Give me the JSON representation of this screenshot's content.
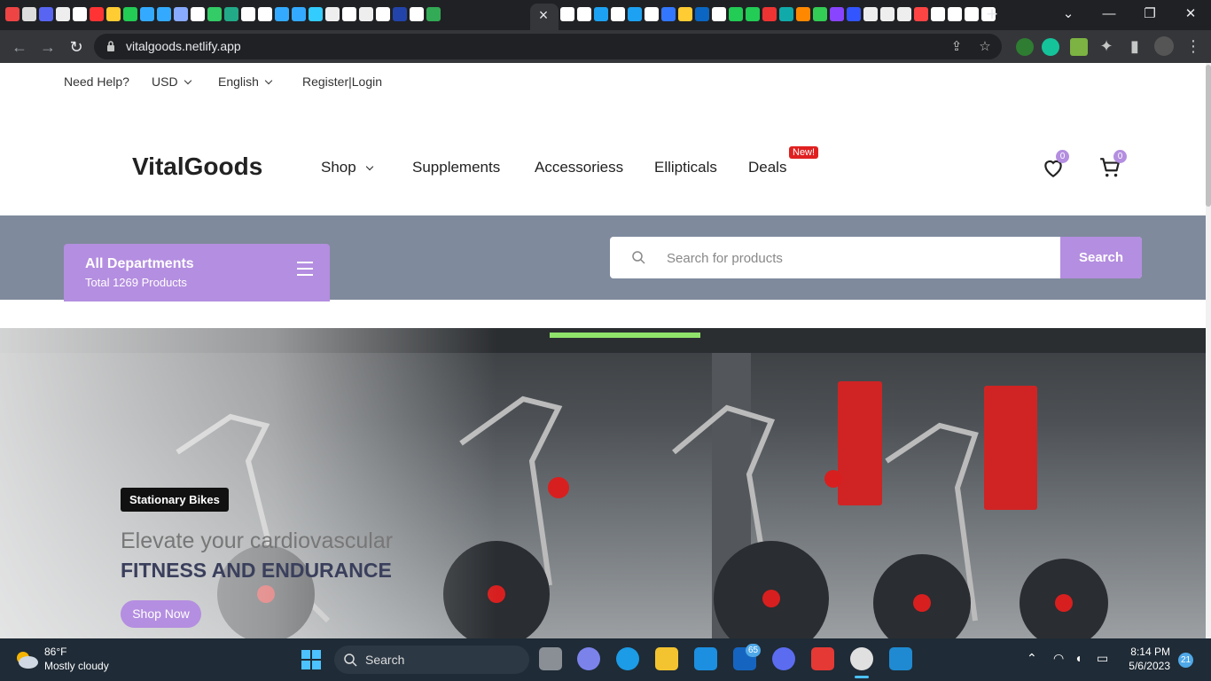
{
  "browser": {
    "url": "vitalgoods.netlify.app",
    "tab_close_glyph": "×",
    "new_tab_glyph": "+",
    "tab_favicon_colors": [
      "#e44",
      "#ddd",
      "#5865f2",
      "#eee",
      "#fff",
      "#f33",
      "#fc3",
      "#2c5",
      "#3af",
      "#3af",
      "#8af",
      "#fff",
      "#3c6",
      "#2a8",
      "#fff",
      "#fff",
      "#3af",
      "#3af",
      "#3cf",
      "#eee",
      "#fff",
      "#eee",
      "#fff",
      "#24a",
      "#fff",
      "#3a5"
    ],
    "tab_favicon_colors2": [
      "#fff",
      "#fff",
      "#1da1f2",
      "#fff",
      "#1da1f2",
      "#fff",
      "#37f",
      "#fc3",
      "#0a66c2",
      "#fff",
      "#2c5",
      "#2c5",
      "#e33",
      "#1aa",
      "#f80",
      "#3c5",
      "#84f",
      "#35f",
      "#eee",
      "#eee",
      "#eee",
      "#f44",
      "#fff",
      "#fff",
      "#fff",
      "#fff"
    ]
  },
  "topbar": {
    "need_help": "Need Help?",
    "currency": "USD",
    "language": "English",
    "auth": "Register|Login"
  },
  "header": {
    "logo": "VitalGoods",
    "nav": [
      "Shop",
      "Supplements",
      "Accessoriess",
      "Ellipticals",
      "Deals"
    ],
    "deals_badge": "New!",
    "wishlist_count": "0",
    "cart_count": "0"
  },
  "departments": {
    "title": "All Departments",
    "subtitle": "Total 1269 Products"
  },
  "search": {
    "placeholder": "Search for products",
    "button": "Search"
  },
  "hero": {
    "tag": "Stationary Bikes",
    "line1": "Elevate your cardiovascular",
    "line2": "FITNESS AND ENDURANCE",
    "cta": "Shop Now"
  },
  "taskbar": {
    "temperature": "86°F",
    "weather": "Mostly cloudy",
    "search": "Search",
    "mail_badge": "65",
    "time": "8:14 PM",
    "date": "5/6/2023",
    "notifications": "21"
  },
  "colors": {
    "accent": "#b48ee0",
    "bar": "#7f8a9d",
    "badge_red": "#e02020"
  }
}
